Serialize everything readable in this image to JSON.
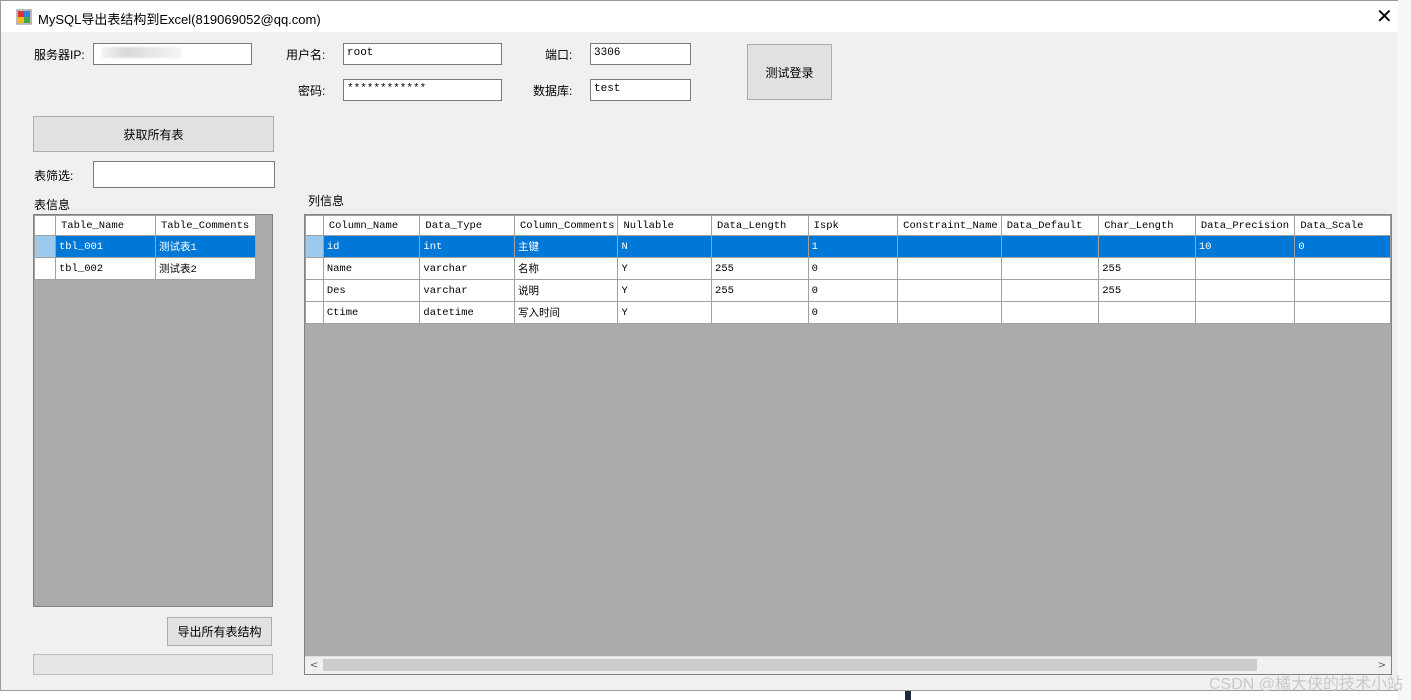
{
  "window": {
    "title": "MySQL导出表结构到Excel(819069052@qq.com)",
    "close_glyph": "✕"
  },
  "connection": {
    "server_ip_label": "服务器IP:",
    "server_ip_value": "",
    "username_label": "用户名:",
    "username_value": "root",
    "port_label": "端口:",
    "port_value": "3306",
    "password_label": "密码:",
    "password_value": "************",
    "database_label": "数据库:",
    "database_value": "test",
    "test_login_label": "测试登录"
  },
  "left": {
    "get_tables_label": "获取所有表",
    "filter_label": "表筛选:",
    "filter_value": "",
    "tables_section_label": "表信息",
    "export_label": "导出所有表结构",
    "tables_grid": {
      "columns": [
        "Table_Name",
        "Table_Comments"
      ],
      "rows": [
        [
          "tbl_001",
          "测试表1"
        ],
        [
          "tbl_002",
          "测试表2"
        ]
      ],
      "selected_row": 0
    }
  },
  "right": {
    "columns_section_label": "列信息",
    "columns_grid": {
      "columns": [
        "Column_Name",
        "Data_Type",
        "Column_Comments",
        "Nullable",
        "Data_Length",
        "Ispk",
        "Constraint_Name",
        "Data_Default",
        "Char_Length",
        "Data_Precision",
        "Data_Scale"
      ],
      "rows": [
        [
          "id",
          "int",
          "主键",
          "N",
          "",
          "1",
          "",
          "",
          "",
          "10",
          "0"
        ],
        [
          "Name",
          "varchar",
          "名称",
          "Y",
          "255",
          "0",
          "",
          "",
          "255",
          "",
          ""
        ],
        [
          "Des",
          "varchar",
          "说明",
          "Y",
          "255",
          "0",
          "",
          "",
          "255",
          "",
          ""
        ],
        [
          "Ctime",
          "datetime",
          "写入时间",
          "Y",
          "",
          "0",
          "",
          "",
          "",
          "",
          ""
        ]
      ],
      "selected_row": 0
    },
    "scroll_left_glyph": "<",
    "scroll_right_glyph": ">"
  },
  "watermark": "CSDN @橘大侠的技术小站"
}
